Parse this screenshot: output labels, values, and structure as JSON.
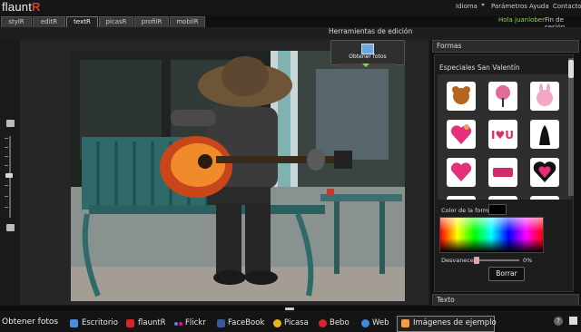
{
  "app": {
    "logo_text": "flaunt",
    "logo_accent": "R"
  },
  "top_menu": {
    "idioma": "Idioma",
    "parametros": "Parámetros",
    "ayuda": "Ayuda",
    "contacto": "Contacto"
  },
  "user": {
    "greeting": "Hola juanlober",
    "logout": "Fin de sesión"
  },
  "tabs": [
    {
      "label": "stylR"
    },
    {
      "label": "editR"
    },
    {
      "label": "textR"
    },
    {
      "label": "picasR"
    },
    {
      "label": "profilR"
    },
    {
      "label": "mobilR"
    }
  ],
  "editor": {
    "tools_title": "Herramientas de edición",
    "obtain_photos": "Obtener fotos"
  },
  "shapes_panel": {
    "title": "Formas",
    "category": "Especiales San Valentín",
    "shape_color_label": "Color de la forma",
    "fade_label": "Desvanecer",
    "fade_value": "0%",
    "erase_button": "Borrar"
  },
  "text_panel": {
    "title": "Texto"
  },
  "bottom_bar": {
    "obtain_photos": "Obtener fotos",
    "items": [
      {
        "label": "Escritorio",
        "icon": "desktop-icon",
        "color": "#4a8de0"
      },
      {
        "label": "flauntR",
        "icon": "flauntr-icon",
        "color": "#d9252a"
      },
      {
        "label": "Flickr",
        "icon": "flickr-icon",
        "color": "#ff0084"
      },
      {
        "label": "FaceBook",
        "icon": "facebook-icon",
        "color": "#3b5998"
      },
      {
        "label": "Picasa",
        "icon": "picasa-icon",
        "color": "#e8b21a"
      },
      {
        "label": "Bebo",
        "icon": "bebo-icon",
        "color": "#d9252a"
      },
      {
        "label": "Web",
        "icon": "web-icon",
        "color": "#3a8fd8"
      },
      {
        "label": "Imágenes de ejemplo",
        "icon": "sample-images-icon",
        "color": "#f0a040"
      }
    ]
  },
  "colors": {
    "accent": "#e23b22",
    "greeting": "#8fd14f",
    "shape_color_swatch": "#000000"
  }
}
